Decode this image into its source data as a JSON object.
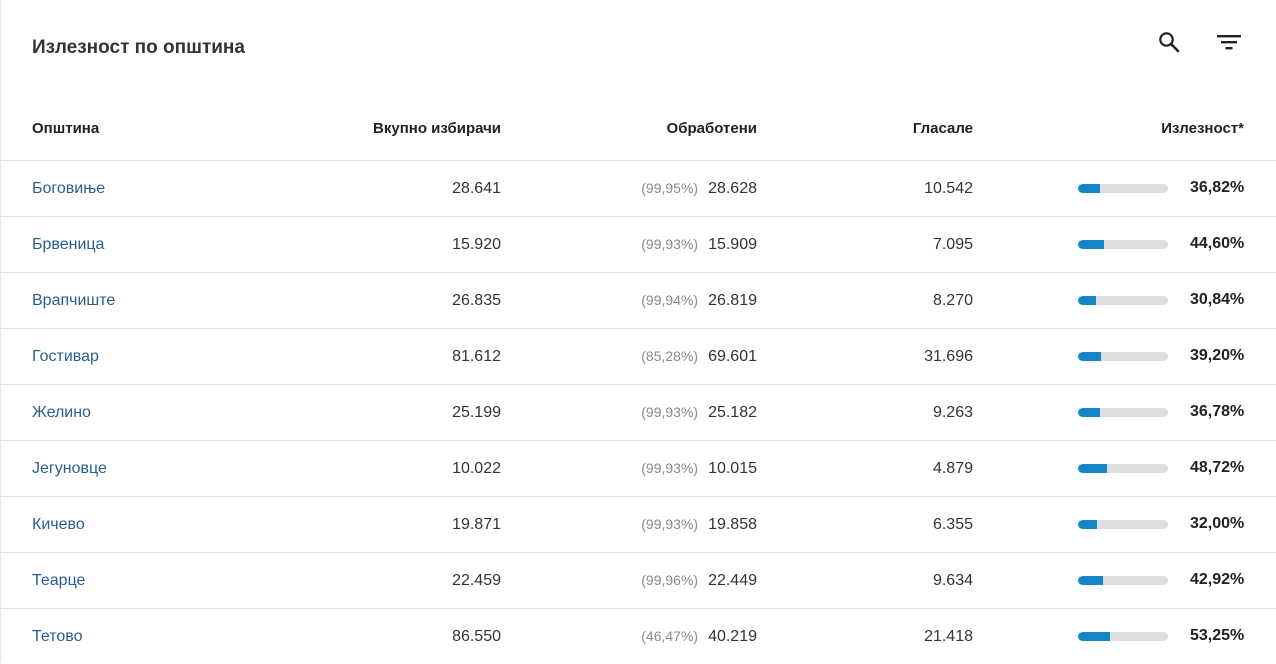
{
  "title": "Излезност по општина",
  "icons": {
    "search": "search-icon",
    "filter": "filter-icon"
  },
  "colors": {
    "accent": "#1786c8",
    "link": "#2a5d8f",
    "bar_track": "#dedede"
  },
  "table": {
    "headers": {
      "name": "Општина",
      "total": "Вкупно избирачи",
      "processed": "Обработени",
      "voted": "Гласале",
      "turnout": "Излезност*"
    },
    "rows": [
      {
        "name": "Боговиње",
        "total": "28.641",
        "processed_pct": "(99,95%)",
        "processed": "28.628",
        "voted": "10.542",
        "turnout": "36,82%",
        "turnout_value": 36.82
      },
      {
        "name": "Брвеница",
        "total": "15.920",
        "processed_pct": "(99,93%)",
        "processed": "15.909",
        "voted": "7.095",
        "turnout": "44,60%",
        "turnout_value": 44.6
      },
      {
        "name": "Врапчиште",
        "total": "26.835",
        "processed_pct": "(99,94%)",
        "processed": "26.819",
        "voted": "8.270",
        "turnout": "30,84%",
        "turnout_value": 30.84
      },
      {
        "name": "Гостивар",
        "total": "81.612",
        "processed_pct": "(85,28%)",
        "processed": "69.601",
        "voted": "31.696",
        "turnout": "39,20%",
        "turnout_value": 39.2
      },
      {
        "name": "Желино",
        "total": "25.199",
        "processed_pct": "(99,93%)",
        "processed": "25.182",
        "voted": "9.263",
        "turnout": "36,78%",
        "turnout_value": 36.78
      },
      {
        "name": "Јегуновце",
        "total": "10.022",
        "processed_pct": "(99,93%)",
        "processed": "10.015",
        "voted": "4.879",
        "turnout": "48,72%",
        "turnout_value": 48.72
      },
      {
        "name": "Кичево",
        "total": "19.871",
        "processed_pct": "(99,93%)",
        "processed": "19.858",
        "voted": "6.355",
        "turnout": "32,00%",
        "turnout_value": 32.0
      },
      {
        "name": "Теарце",
        "total": "22.459",
        "processed_pct": "(99,96%)",
        "processed": "22.449",
        "voted": "9.634",
        "turnout": "42,92%",
        "turnout_value": 42.92
      },
      {
        "name": "Тетово",
        "total": "86.550",
        "processed_pct": "(46,47%)",
        "processed": "40.219",
        "voted": "21.418",
        "turnout": "53,25%",
        "turnout_value": 53.25
      }
    ]
  }
}
